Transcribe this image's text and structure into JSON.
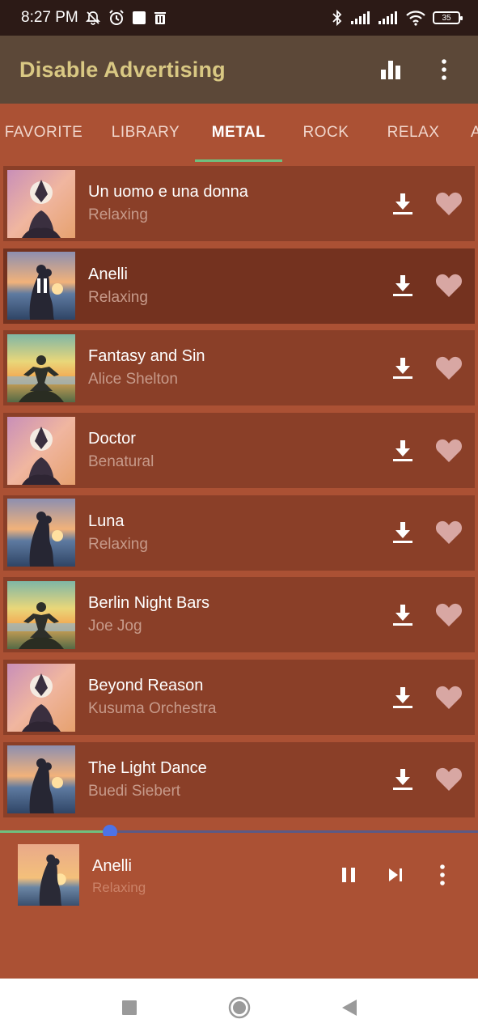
{
  "status_bar": {
    "time": "8:27 PM",
    "battery": "35",
    "icons": [
      "muted-bell-icon",
      "alarm-icon",
      "square-icon",
      "trash-icon",
      "bluetooth-icon",
      "signal-icon",
      "signal-icon",
      "wifi-icon",
      "battery-icon"
    ]
  },
  "app_bar": {
    "title": "Disable Advertising",
    "icons": [
      "bar-chart-icon",
      "more-vert-icon"
    ]
  },
  "tabs": [
    {
      "label": "FAVORITE"
    },
    {
      "label": "LIBRARY"
    },
    {
      "label": "METAL"
    },
    {
      "label": "ROCK"
    },
    {
      "label": "RELAX"
    },
    {
      "label": "A"
    }
  ],
  "active_tab": "METAL",
  "tracks": [
    {
      "title": "Un uomo e una donna",
      "artist": "Relaxing",
      "art": "yoga-meditation"
    },
    {
      "title": "Anelli",
      "artist": "Relaxing",
      "art": "couple-sunset"
    },
    {
      "title": "Fantasy and Sin",
      "artist": "Alice Shelton",
      "art": "meditation-beach"
    },
    {
      "title": "Doctor",
      "artist": "Benatural",
      "art": "yoga-meditation"
    },
    {
      "title": "Luna",
      "artist": "Relaxing",
      "art": "couple-sunset"
    },
    {
      "title": "Berlin Night Bars",
      "artist": "Joe Jog",
      "art": "meditation-beach"
    },
    {
      "title": "Beyond Reason",
      "artist": "Kusuma Orchestra",
      "art": "yoga-meditation"
    },
    {
      "title": "The Light Dance",
      "artist": "Buedi Siebert",
      "art": "couple-sunset"
    }
  ],
  "playing_index": 1,
  "now_playing": {
    "title": "Anelli",
    "artist": "Relaxing",
    "progress": 0.23,
    "icons": [
      "pause-icon",
      "skip-next-icon",
      "more-vert-icon"
    ]
  },
  "nav_bar": {
    "icons": [
      "recents-square-icon",
      "home-circle-icon",
      "back-triangle-icon"
    ]
  },
  "colors": {
    "status_bar": "#2c1a16",
    "app_bar": "#5c4838",
    "title": "#d9c883",
    "background": "#ab5134",
    "row": "#8a3f28",
    "row_playing": "#74321f",
    "tab_indicator": "#6fc07f",
    "progress_thumb": "#4d73e6"
  }
}
